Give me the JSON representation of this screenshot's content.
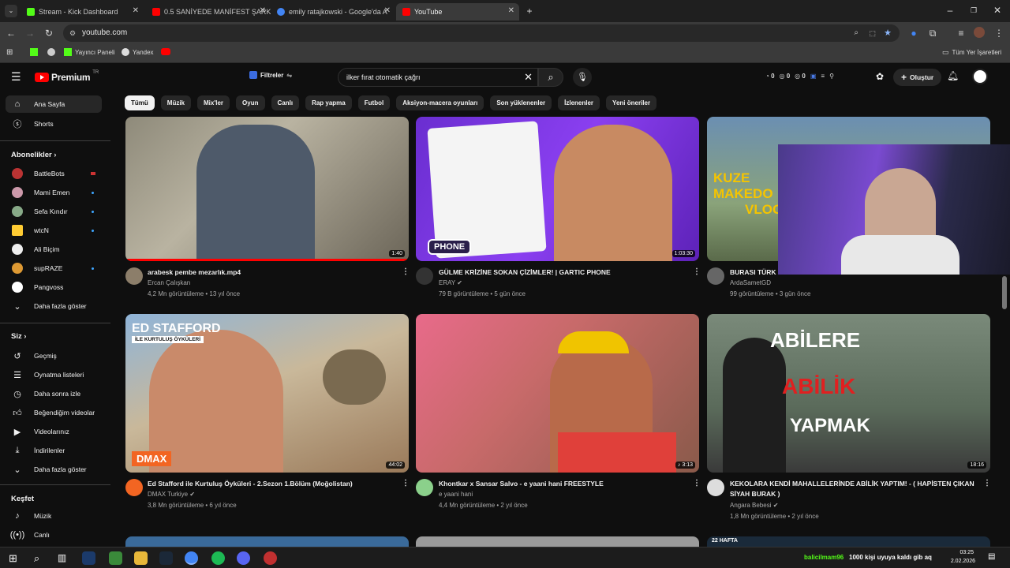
{
  "tabs": [
    {
      "label": "Stream - Kick Dashboard",
      "color": "#53fc18"
    },
    {
      "label": "0.5 SANİYEDE MANİFEST ŞARKI",
      "color": "#ff0000"
    },
    {
      "label": "emily ratajkowski - Google'da A",
      "color": "#4285f4"
    },
    {
      "label": "YouTube",
      "color": "#ff0000"
    }
  ],
  "address": {
    "url": "youtube.com"
  },
  "bookmarks": {
    "items": [
      "Yayıncı Paneli",
      "Yandex"
    ],
    "all_bookmarks": "Tüm Yer İşaretleri"
  },
  "header": {
    "logo": "Premium",
    "region": "TR",
    "filters_label": "Filtreler",
    "search_value": "ilker fırat otomatik çağrı",
    "ext_counts": [
      "0",
      "0",
      "0"
    ],
    "create_label": "Oluştur"
  },
  "chips": [
    "Tümü",
    "Müzik",
    "Mix'ler",
    "Oyun",
    "Canlı",
    "Rap yapma",
    "Futbol",
    "Aksiyon-macera oyunları",
    "Son yüklenenler",
    "İzlenenler",
    "Yeni öneriler"
  ],
  "sidebar": {
    "home": "Ana Sayfa",
    "shorts": "Shorts",
    "subs_head": "Abonelikler",
    "subs": [
      "BattleBots",
      "Mami Emen",
      "Sefa Kındır",
      "wtcN",
      "Ali Biçim",
      "supRAZE",
      "Pangvoss"
    ],
    "show_more": "Daha fazla göster",
    "you_head": "Siz",
    "you_items": [
      "Geçmiş",
      "Oynatma listeleri",
      "Daha sonra izle",
      "Beğendiğim videolar",
      "Videolarınız",
      "İndirilenler"
    ],
    "show_more2": "Daha fazla göster",
    "explore_head": "Keşfet",
    "explore_items": [
      "Müzik",
      "Canlı"
    ]
  },
  "videos": [
    {
      "title": "arabesk pembe mezarlık.mp4",
      "channel": "Ercan Çalışkan",
      "views": "4,2 Mn görüntüleme",
      "age": "13 yıl önce",
      "duration": "1:40"
    },
    {
      "title": "GÜLME KRİZİNE SOKAN ÇİZİMLER! | GARTIC PHONE",
      "channel": "ERAY",
      "views": "79 B görüntüleme",
      "age": "5 gün önce",
      "duration": "1:03:30"
    },
    {
      "title": "BURASI TÜRK",
      "channel": "ArdaSametGD",
      "views": "99 görüntüleme",
      "age": "3 gün önce",
      "duration": ""
    },
    {
      "title": "Ed Stafford ile Kurtuluş Öyküleri - 2.Sezon 1.Bölüm (Moğolistan)",
      "channel": "DMAX Turkiye",
      "views": "3,8 Mn görüntüleme",
      "age": "6 yıl önce",
      "duration": "44:02"
    },
    {
      "title": "Khontkar x Sansar Salvo - e yaani hani FREESTYLE",
      "channel": "e yaani hani",
      "views": "4,4 Mn görüntüleme",
      "age": "2 yıl önce",
      "duration": "3:13"
    },
    {
      "title": "KEKOLARA KENDİ MAHALLELERİNDE ABİLİK YAPTIM! - ( HAPİSTEN ÇIKAN SİYAH BURAK )",
      "channel": "Angara Bebesi",
      "views": "1,8 Mn görüntüleme",
      "age": "2 yıl önce",
      "duration": "18:16"
    }
  ],
  "thumb_text": {
    "gartic": "PHONE",
    "ed": "ED STAFFORD",
    "ed_sub": "İLE KURTULUŞ ÖYKÜLERİ",
    "dmax": "DMAX",
    "abilere1": "ABİLERE",
    "abilere2": "ABİLİK",
    "abilere3": "YAPMAK",
    "kuze": "KUZE",
    "makedo": "MAKEDO",
    "vlog": "VLOG",
    "hafta": "22 HAFTA"
  },
  "taskbar": {
    "user": "balicilmam96",
    "notice": "1000 kişi uyuya kaldı gib aq",
    "time": "03:25",
    "date": "2.02.2026"
  }
}
